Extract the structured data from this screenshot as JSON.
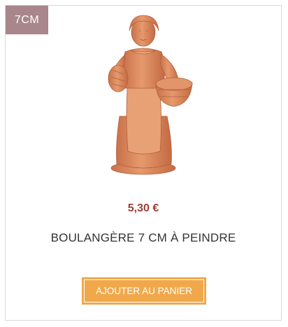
{
  "product": {
    "badge": "7CM",
    "image_alt": "boulangere-figurine",
    "price": "5,30 €",
    "title": "BOULANGÈRE 7 CM À PEINDRE",
    "add_to_cart_label": "AJOUTER AU PANIER"
  },
  "colors": {
    "badge_bg": "#a8868b",
    "price": "#9e3f33",
    "button_bg": "#f0a84a",
    "terracotta": "#d9875a"
  }
}
